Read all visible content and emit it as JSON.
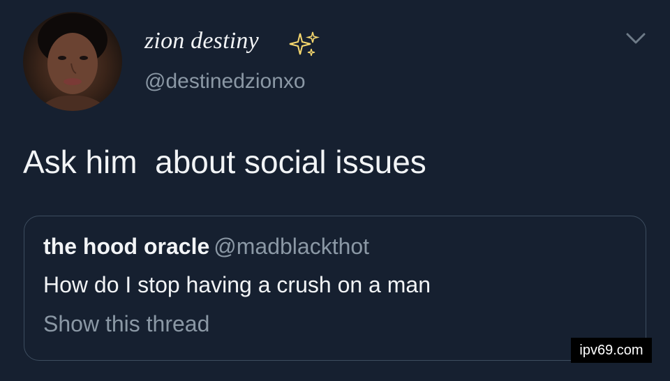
{
  "tweet": {
    "display_name": "zion destiny",
    "handle": "@destinedzionxo",
    "text": "Ask him  about social issues",
    "avatar_icon": "profile-photo",
    "sparkle_icon": "sparkles-emoji",
    "menu_icon": "chevron-down-icon"
  },
  "quote": {
    "display_name": "the hood oracle",
    "handle": "@madblackthot",
    "text": "How do I stop having a crush on a man",
    "show_thread": "Show this thread"
  },
  "watermark": {
    "text": "ipv69.com"
  },
  "colors": {
    "background": "#162030",
    "primary_text": "#f2f4f6",
    "secondary_text": "#8b98a5",
    "border": "#3d4d5f",
    "sparkle": "#f5d76e"
  }
}
